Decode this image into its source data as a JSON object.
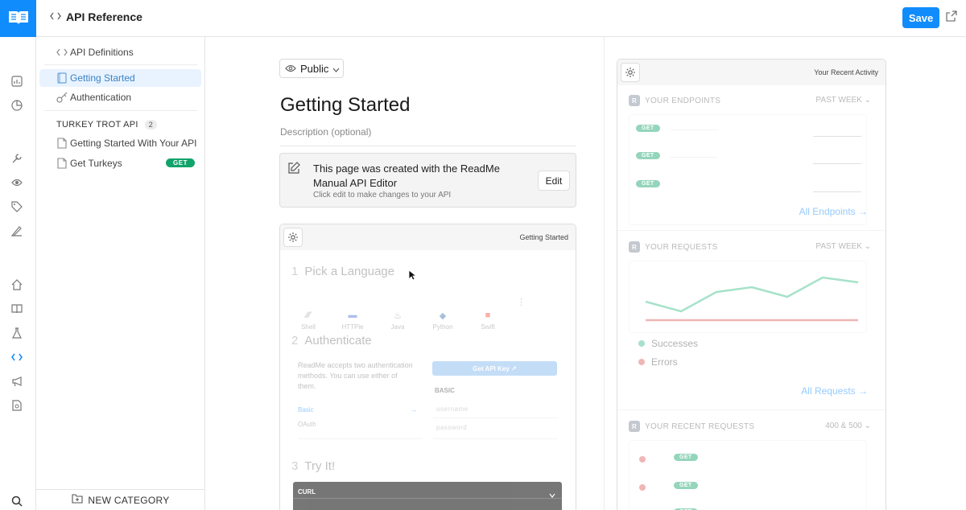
{
  "header": {
    "title": "API Reference",
    "save_label": "Save"
  },
  "sidebar": {
    "items": [
      {
        "label": "API Definitions",
        "icon": "code-icon"
      },
      {
        "label": "Getting Started",
        "icon": "book-icon",
        "active": true
      },
      {
        "label": "Authentication",
        "icon": "key-icon"
      }
    ],
    "section": {
      "label": "TURKEY TROT API",
      "count": "2"
    },
    "section_items": [
      {
        "label": "Getting Started With Your API",
        "icon": "doc-icon"
      },
      {
        "label": "Get Turkeys",
        "icon": "doc-icon",
        "badge": "GET"
      }
    ],
    "new_category": "NEW CATEGORY"
  },
  "editor": {
    "visibility": "Public",
    "page_title": "Getting Started",
    "description_placeholder": "Description (optional)",
    "notice_title": "This page was created with the ReadMe Manual API Editor",
    "notice_sub": "Click edit to make changes to your API",
    "edit_label": "Edit"
  },
  "preview": {
    "title": "Getting Started",
    "step1": {
      "num": "1",
      "label": "Pick a Language"
    },
    "languages": [
      "Shell",
      "HTTPie",
      "Java",
      "Python",
      "Swift"
    ],
    "step2": {
      "num": "2",
      "label": "Authenticate"
    },
    "auth_text": "ReadMe accepts two authentication methods. You can use either of them.",
    "api_key_btn": "Get API Key ↗",
    "basic_head": "BASIC",
    "auth_methods": [
      "Basic",
      "OAuth"
    ],
    "username_ph": "username",
    "password_ph": "password",
    "step3": {
      "num": "3",
      "label": "Try It!"
    },
    "curl_label": "CURL"
  },
  "activity": {
    "title": "Your Recent Activity",
    "endpoints": {
      "label": "YOUR ENDPOINTS",
      "filter": "PAST WEEK",
      "badge": "GET",
      "link": "All Endpoints →"
    },
    "requests": {
      "label": "YOUR REQUESTS",
      "filter": "PAST WEEK",
      "link": "All Requests →",
      "legend": [
        "Successes",
        "Errors"
      ]
    },
    "recent": {
      "label": "YOUR RECENT REQUESTS",
      "filter": "400 & 500",
      "badge": "GET"
    },
    "avatar_letter": "R"
  },
  "colors": {
    "accent": "#118cfd",
    "get_green": "#12a36b",
    "success": "#5cc9a0",
    "error": "#e88a8a"
  }
}
